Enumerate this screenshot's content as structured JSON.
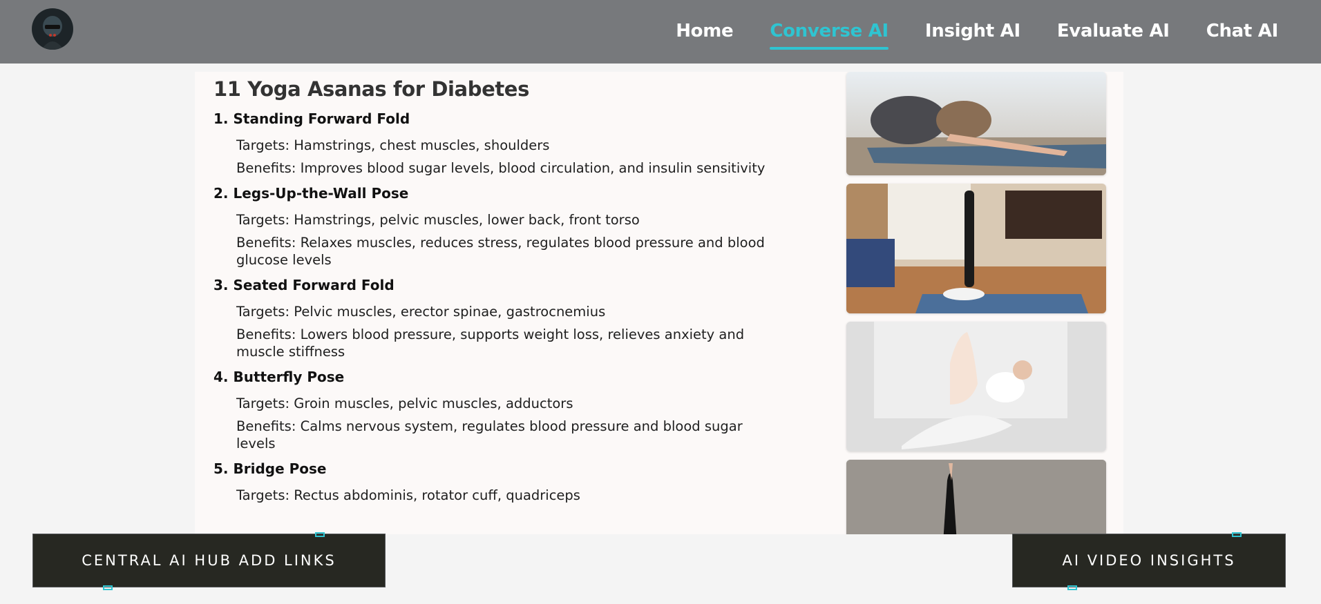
{
  "nav": {
    "items": [
      {
        "label": "Home",
        "active": false
      },
      {
        "label": "Converse AI",
        "active": true
      },
      {
        "label": "Insight AI",
        "active": false
      },
      {
        "label": "Evaluate AI",
        "active": false
      },
      {
        "label": "Chat AI",
        "active": false
      }
    ],
    "accent_color": "#2fc4d1"
  },
  "article": {
    "title": "11 Yoga Asanas for Diabetes",
    "asanas": [
      {
        "name": "1. Standing Forward Fold",
        "targets": "Targets: Hamstrings, chest muscles, shoulders",
        "benefits": "Benefits: Improves blood sugar levels, blood circulation, and insulin sensitivity"
      },
      {
        "name": "2. Legs-Up-the-Wall Pose",
        "targets": "Targets: Hamstrings, pelvic muscles, lower back, front torso",
        "benefits": "Benefits: Relaxes muscles, reduces stress, regulates blood pressure and blood glucose levels"
      },
      {
        "name": "3. Seated Forward Fold",
        "targets": "Targets: Pelvic muscles, erector spinae, gastrocnemius",
        "benefits": "Benefits: Lowers blood pressure, supports weight loss, relieves anxiety and muscle stiffness"
      },
      {
        "name": "4. Butterfly Pose",
        "targets": "Targets: Groin muscles, pelvic muscles, adductors",
        "benefits": "Benefits: Calms nervous system, regulates blood pressure and blood sugar levels"
      },
      {
        "name": "5. Bridge Pose",
        "targets": "Targets: Rectus abdominis, rotator cuff, quadriceps",
        "benefits": ""
      }
    ]
  },
  "buttons": {
    "left_label": "CENTRAL AI HUB ADD LINKS",
    "right_label": "AI VIDEO INSIGHTS"
  }
}
